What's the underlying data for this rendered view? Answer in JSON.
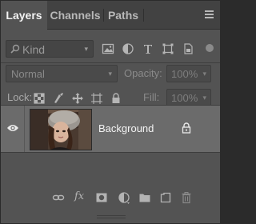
{
  "tabs": [
    {
      "label": "Layers",
      "active": true
    },
    {
      "label": "Channels",
      "active": false
    },
    {
      "label": "Paths",
      "active": false
    }
  ],
  "filter": {
    "kind_label": "Kind",
    "icons": [
      "pixel-filter-icon",
      "adjustment-filter-icon",
      "type-filter-icon",
      "shape-filter-icon",
      "smart-object-filter-icon"
    ]
  },
  "blend": {
    "mode": "Normal",
    "opacity_label": "Opacity:",
    "opacity_value": "100%"
  },
  "lock": {
    "label": "Lock:",
    "icons": [
      "lock-transparent-icon",
      "lock-image-icon",
      "lock-position-icon",
      "lock-artboard-icon",
      "lock-all-icon"
    ],
    "fill_label": "Fill:",
    "fill_value": "100%"
  },
  "layer": {
    "name": "Background",
    "visible": true,
    "locked": true
  },
  "footer_icons": [
    "link-layers-icon",
    "fx-icon",
    "add-mask-icon",
    "adjustment-layer-icon",
    "new-group-icon",
    "new-layer-icon",
    "delete-layer-icon"
  ],
  "footer": {
    "fx_label": "fx"
  },
  "colors": {
    "panel_bg": "#535353",
    "tab_bar_bg": "#424242",
    "selected_layer_bg": "#6b6b6b"
  }
}
